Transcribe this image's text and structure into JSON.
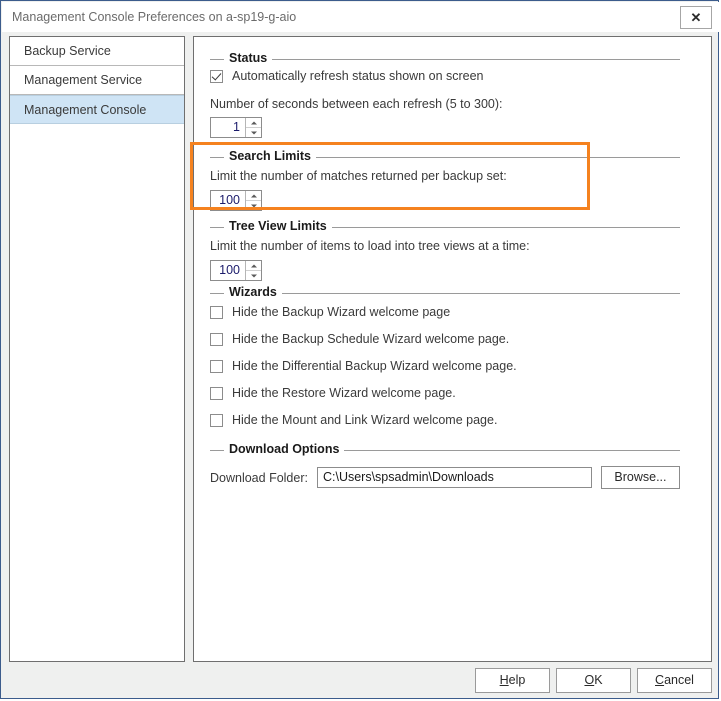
{
  "window": {
    "title": "Management Console Preferences on a-sp19-g-aio",
    "close_label": "✕"
  },
  "sidebar": {
    "items": [
      {
        "label": "Backup Service",
        "selected": false
      },
      {
        "label": "Management Service",
        "selected": false
      },
      {
        "label": "Management Console",
        "selected": true
      }
    ]
  },
  "groups": {
    "status": {
      "title": "Status",
      "checkbox_label": "Automatically refresh status shown on screen",
      "checkbox_checked": true,
      "refresh_label": "Number of seconds between each refresh (5 to 300):",
      "refresh_value": "1"
    },
    "search_limits": {
      "title": "Search Limits",
      "description": "Limit the number of matches returned per backup set:",
      "value": "100",
      "highlighted": true,
      "highlight_color": "#f5821f"
    },
    "tree_view_limits": {
      "title": "Tree View Limits",
      "description": "Limit the number of items to load into tree views at a time:",
      "value": "100"
    },
    "wizards": {
      "title": "Wizards",
      "items": [
        {
          "label": "Hide the Backup Wizard welcome page",
          "checked": false
        },
        {
          "label": "Hide the Backup Schedule Wizard welcome page.",
          "checked": false
        },
        {
          "label": "Hide the Differential Backup Wizard welcome page.",
          "checked": false
        },
        {
          "label": "Hide the Restore Wizard welcome page.",
          "checked": false
        },
        {
          "label": "Hide the Mount and Link Wizard welcome page.",
          "checked": false
        }
      ]
    },
    "download_options": {
      "title": "Download Options",
      "folder_label": "Download Folder:",
      "folder_value": "C:\\Users\\spsadmin\\Downloads",
      "browse_label": "Browse..."
    }
  },
  "footer": {
    "help": {
      "accesskey": "H",
      "rest": "elp"
    },
    "ok": {
      "accesskey": "O",
      "rest": "K"
    },
    "cancel": {
      "accesskey": "C",
      "rest": "ancel"
    }
  },
  "colors": {
    "selection_blue": "#cfe4f5",
    "dialog_border": "#3c5c8c",
    "highlight_orange": "#f5821f",
    "spin_value_text": "#1b1b6b"
  }
}
